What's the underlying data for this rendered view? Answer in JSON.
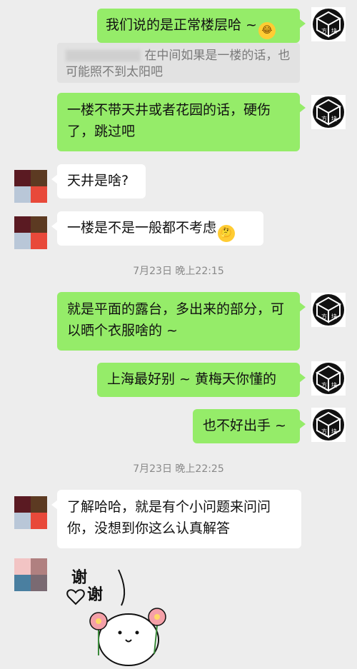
{
  "messages": [
    {
      "side": "right",
      "text": "我们说的是正常楼层哈 ~",
      "emoji": "laughing-tears"
    },
    {
      "side": "quote",
      "text": "在中间如果是一楼的话，也可能照不到太阳吧"
    },
    {
      "side": "right",
      "text": "一楼不带天井或者花园的话，硬伤了，跳过吧"
    },
    {
      "side": "left",
      "text": "天井是啥?"
    },
    {
      "side": "left",
      "text": "一楼是不是一般都不考虑",
      "emoji": "thinking"
    },
    {
      "side": "right",
      "text": "就是平面的露台，多出来的部分，可以晒个衣服啥的 ~"
    },
    {
      "side": "right",
      "text": "上海最好别 ~ 黄梅天你懂的"
    },
    {
      "side": "right",
      "text": "也不好出手 ~"
    },
    {
      "side": "left",
      "text": "了解哈哈，就是有个小问题来问问你，没想到你这么认真解答"
    }
  ],
  "timestamps": [
    "7月23日 晚上22:15",
    "7月23日 晚上22:25"
  ],
  "avatar_right": {
    "label_left": "方",
    "label_right": "块"
  },
  "sticker": {
    "text_1": "谢",
    "text_2": "谢"
  },
  "colors": {
    "bubble_self": "#95ec69",
    "bubble_other": "#ffffff",
    "background": "#ededed"
  }
}
